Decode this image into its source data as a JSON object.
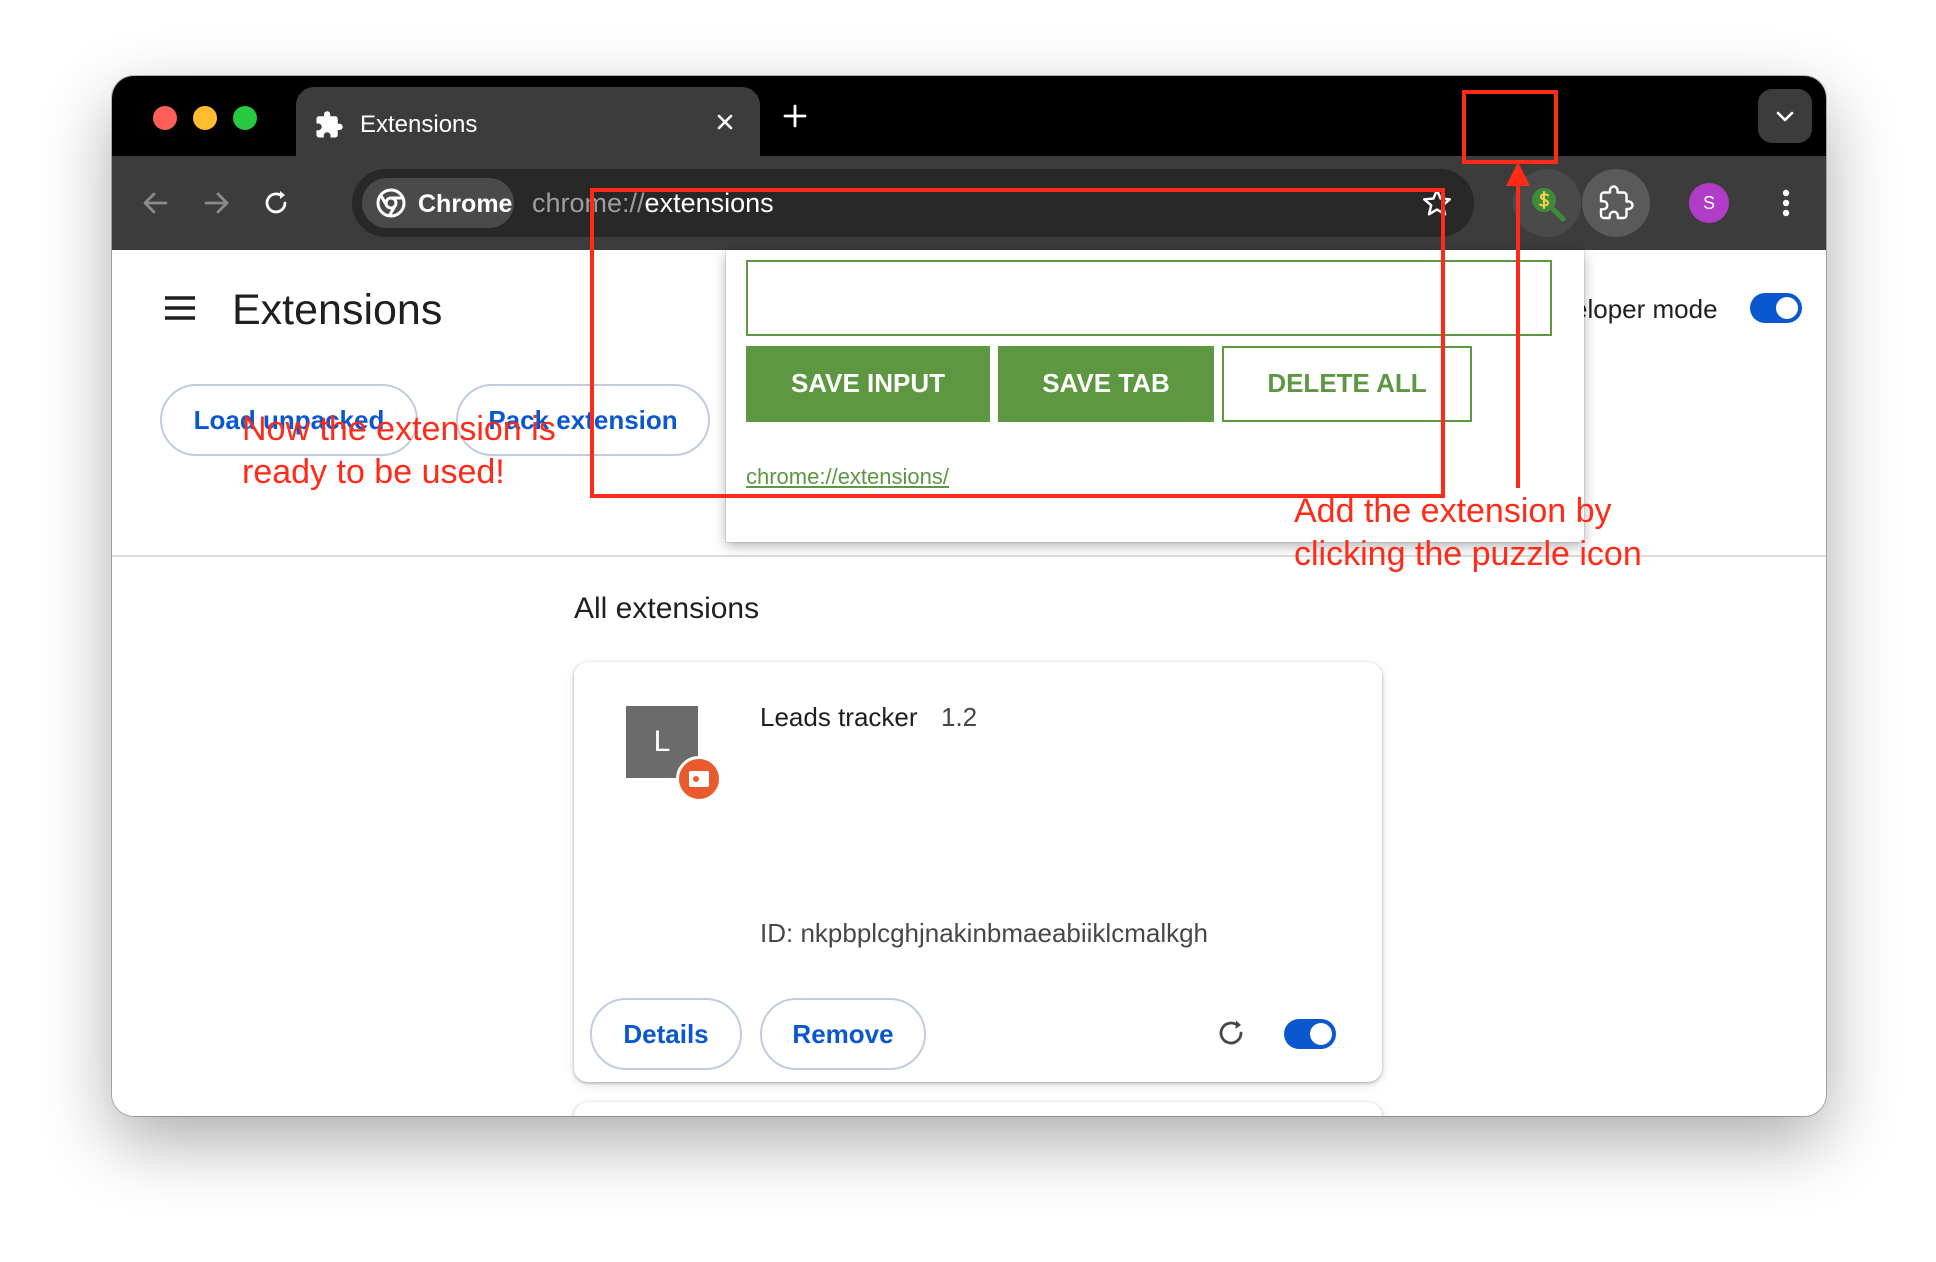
{
  "browser": {
    "tab": {
      "title": "Extensions",
      "icon": "puzzle-icon"
    },
    "chip_label": "Chrome",
    "url_prefix": "chrome://",
    "url_host": "extensions",
    "profile_initial": "S"
  },
  "page": {
    "title": "Extensions",
    "developer_mode_label": "veloper mode",
    "developer_mode_on": true,
    "buttons": {
      "load_unpacked": "Load unpacked",
      "pack_extension": "Pack extension"
    },
    "section_title": "All extensions",
    "extension": {
      "icon_letter": "L",
      "name": "Leads tracker",
      "version": "1.2",
      "id": "ID: nkpbplcghjnakinbmaeabiiklcmalkgh",
      "details_label": "Details",
      "remove_label": "Remove",
      "enabled": true
    }
  },
  "popup": {
    "input_value": "",
    "save_input_label": "SAVE INPUT",
    "save_tab_label": "SAVE TAB",
    "delete_all_label": "DELETE ALL",
    "saved_links": [
      "chrome://extensions/"
    ],
    "accent_color": "#5d9742"
  },
  "annotations": {
    "left_line1": "Now the extension is",
    "left_line2": "ready to be used!",
    "right_line1": "Add the extension by",
    "right_line2": "clicking the puzzle icon",
    "color": "#ff2a17"
  }
}
